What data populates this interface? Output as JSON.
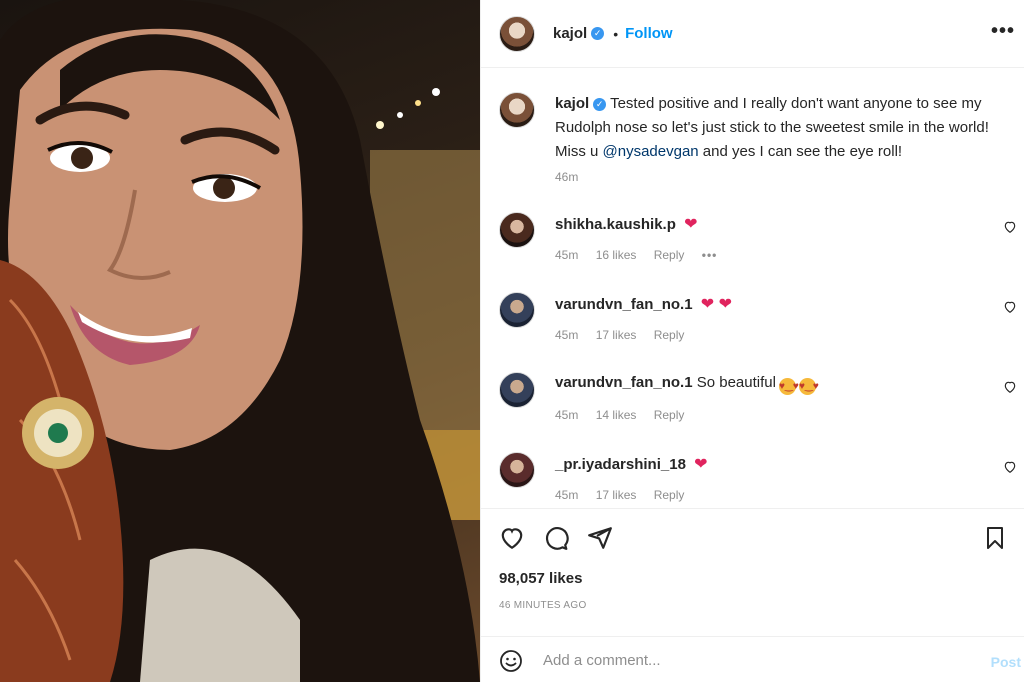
{
  "post": {
    "username": "kajol",
    "follow_label": "Follow",
    "more_label": "•••",
    "caption_user": "kajol",
    "caption_before_mention": "Tested positive and I really don't want anyone to see my Rudolph nose so let's just stick to the sweetest smile in the world! Miss u ",
    "caption_mention": "@nysadevgan",
    "caption_after_mention": " and yes I can see the eye roll!",
    "caption_time": "46m",
    "likes": "98,057 likes",
    "time_ago": "46 MINUTES AGO"
  },
  "comments": [
    {
      "user": "shikha.kaushik.p",
      "text": "",
      "emoji": "❤",
      "time": "45m",
      "likes": "16 likes",
      "reply": "Reply",
      "more": "•••"
    },
    {
      "user": "varundvn_fan_no.1",
      "text": "",
      "emoji": "❤ ❤",
      "time": "45m",
      "likes": "17 likes",
      "reply": "Reply"
    },
    {
      "user": "varundvn_fan_no.1",
      "text": "So beautiful",
      "emoji": "",
      "time": "45m",
      "likes": "14 likes",
      "reply": "Reply"
    },
    {
      "user": "_pr.iyadarshini_18",
      "text": "",
      "emoji": "❤",
      "time": "45m",
      "likes": "17 likes",
      "reply": "Reply"
    }
  ],
  "add_comment": {
    "placeholder": "Add a comment...",
    "post_label": "Post"
  },
  "colors": {
    "link": "#0095f6",
    "mention": "#00376b",
    "muted": "#8e8e8e",
    "heart": "#e0245e"
  },
  "icons": [
    "verified-badge-icon",
    "like-icon",
    "comment-icon",
    "share-icon",
    "save-icon",
    "emoji-icon",
    "comment-like-icon"
  ]
}
